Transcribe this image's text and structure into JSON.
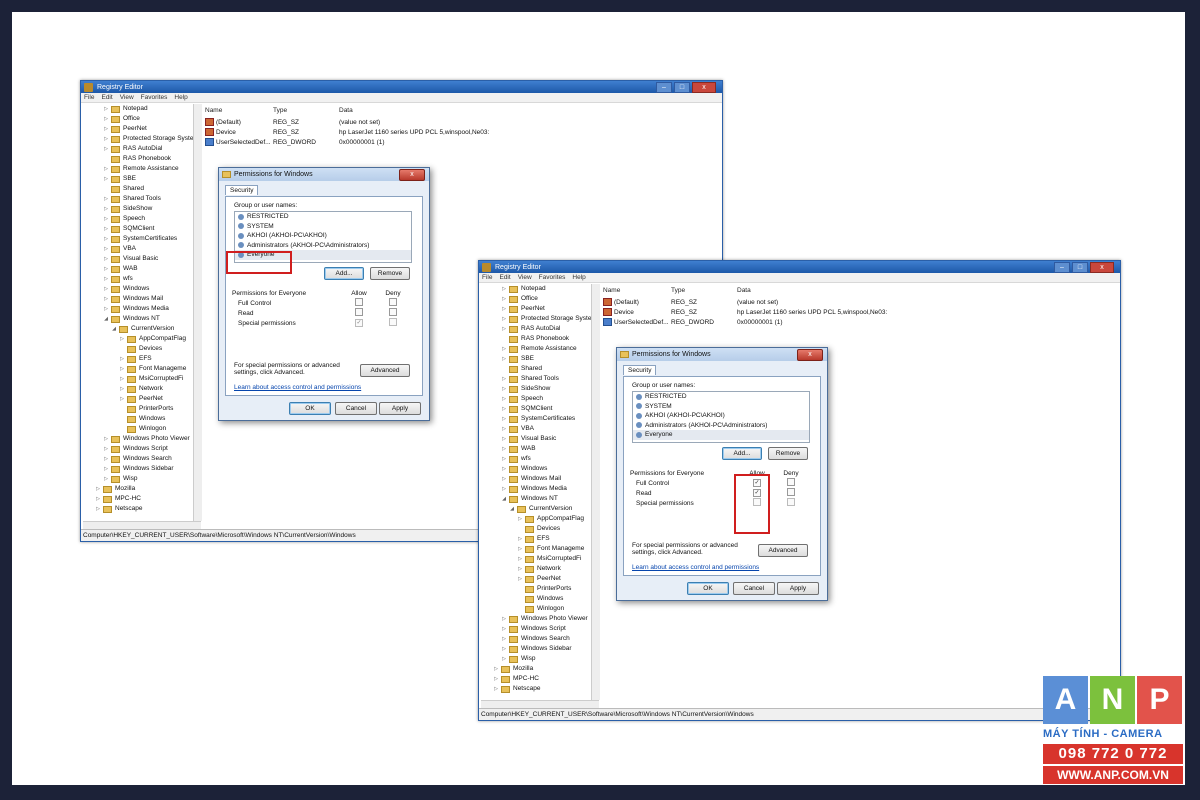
{
  "registry": {
    "title": "Registry Editor",
    "menu": [
      "File",
      "Edit",
      "View",
      "Favorites",
      "Help"
    ],
    "window_controls": [
      "–",
      "□",
      "x"
    ],
    "tree": [
      {
        "label": "Notepad",
        "indent": 2,
        "expander": "▷"
      },
      {
        "label": "Office",
        "indent": 2,
        "expander": "▷"
      },
      {
        "label": "PeerNet",
        "indent": 2,
        "expander": "▷"
      },
      {
        "label": "Protected Storage Syste",
        "indent": 2,
        "expander": "▷"
      },
      {
        "label": "RAS AutoDial",
        "indent": 2,
        "expander": "▷"
      },
      {
        "label": "RAS Phonebook",
        "indent": 2,
        "expander": ""
      },
      {
        "label": "Remote Assistance",
        "indent": 2,
        "expander": "▷"
      },
      {
        "label": "SBE",
        "indent": 2,
        "expander": "▷"
      },
      {
        "label": "Shared",
        "indent": 2,
        "expander": ""
      },
      {
        "label": "Shared Tools",
        "indent": 2,
        "expander": "▷"
      },
      {
        "label": "SideShow",
        "indent": 2,
        "expander": "▷"
      },
      {
        "label": "Speech",
        "indent": 2,
        "expander": "▷"
      },
      {
        "label": "SQMClient",
        "indent": 2,
        "expander": "▷"
      },
      {
        "label": "SystemCertificates",
        "indent": 2,
        "expander": "▷"
      },
      {
        "label": "VBA",
        "indent": 2,
        "expander": "▷"
      },
      {
        "label": "Visual Basic",
        "indent": 2,
        "expander": "▷"
      },
      {
        "label": "WAB",
        "indent": 2,
        "expander": "▷"
      },
      {
        "label": "wfs",
        "indent": 2,
        "expander": "▷"
      },
      {
        "label": "Windows",
        "indent": 2,
        "expander": "▷"
      },
      {
        "label": "Windows Mail",
        "indent": 2,
        "expander": "▷"
      },
      {
        "label": "Windows Media",
        "indent": 2,
        "expander": "▷"
      },
      {
        "label": "Windows NT",
        "indent": 2,
        "expander": "◢"
      },
      {
        "label": "CurrentVersion",
        "indent": 3,
        "expander": "◢"
      },
      {
        "label": "AppCompatFlag",
        "indent": 4,
        "expander": "▷"
      },
      {
        "label": "Devices",
        "indent": 4,
        "expander": ""
      },
      {
        "label": "EFS",
        "indent": 4,
        "expander": "▷"
      },
      {
        "label": "Font Manageme",
        "indent": 4,
        "expander": "▷"
      },
      {
        "label": "MsiCorruptedFi",
        "indent": 4,
        "expander": "▷"
      },
      {
        "label": "Network",
        "indent": 4,
        "expander": "▷"
      },
      {
        "label": "PeerNet",
        "indent": 4,
        "expander": "▷"
      },
      {
        "label": "PrinterPorts",
        "indent": 4,
        "expander": ""
      },
      {
        "label": "Windows",
        "indent": 4,
        "expander": ""
      },
      {
        "label": "Winlogon",
        "indent": 4,
        "expander": ""
      },
      {
        "label": "Windows Photo Viewer",
        "indent": 2,
        "expander": "▷"
      },
      {
        "label": "Windows Script",
        "indent": 2,
        "expander": "▷"
      },
      {
        "label": "Windows Search",
        "indent": 2,
        "expander": "▷"
      },
      {
        "label": "Windows Sidebar",
        "indent": 2,
        "expander": "▷"
      },
      {
        "label": "Wisp",
        "indent": 2,
        "expander": "▷"
      },
      {
        "label": "Mozilla",
        "indent": 1,
        "expander": "▷"
      },
      {
        "label": "MPC-HC",
        "indent": 1,
        "expander": "▷"
      },
      {
        "label": "Netscape",
        "indent": 1,
        "expander": "▷"
      }
    ],
    "columns": {
      "name": "Name",
      "type": "Type",
      "data": "Data"
    },
    "values": [
      {
        "name": "(Default)",
        "type": "REG_SZ",
        "data": "(value not set)",
        "icon": "string-value-icon"
      },
      {
        "name": "Device",
        "type": "REG_SZ",
        "data": "hp LaserJet 1160 series UPD PCL 5,winspool,Ne03:",
        "icon": "string-value-icon"
      },
      {
        "name": "UserSelectedDef...",
        "type": "REG_DWORD",
        "data": "0x00000001 (1)",
        "icon": "dword-value-icon"
      }
    ],
    "status_path": "Computer\\HKEY_CURRENT_USER\\Software\\Microsoft\\Windows NT\\CurrentVersion\\Windows"
  },
  "dialog": {
    "title": "Permissions for Windows",
    "close": "x",
    "tab": "Security",
    "group_label": "Group or user names:",
    "users": [
      "RESTRICTED",
      "SYSTEM",
      "AKHOI (AKHOI-PC\\AKHOI)",
      "Administrators (AKHOI-PC\\Administrators)",
      "Everyone"
    ],
    "add": "Add...",
    "remove": "Remove",
    "perm_header": "Permissions for Everyone",
    "allow": "Allow",
    "deny": "Deny",
    "perms": [
      "Full Control",
      "Read",
      "Special permissions"
    ],
    "special_note": "For special permissions or advanced settings, click Advanced.",
    "advanced": "Advanced",
    "learn_link": "Learn about access control and permissions",
    "ok": "OK",
    "cancel": "Cancel",
    "apply": "Apply"
  },
  "dialog_state_1": {
    "allow": [
      false,
      false,
      true
    ],
    "deny": [
      false,
      false,
      false
    ]
  },
  "dialog_state_2": {
    "allow": [
      true,
      true,
      false
    ],
    "deny": [
      false,
      false,
      false
    ]
  },
  "logo": {
    "letters": [
      "A",
      "N",
      "P"
    ],
    "tagline": "MÁY TÍNH - CAMERA",
    "phone": "098 772 0 772",
    "website": "WWW.ANP.COM.VN",
    "colors": {
      "a": "#5b8fd6",
      "n": "#7cc13d",
      "p": "#e2534b",
      "text": "#2b6cc4",
      "band": "#d8342c"
    }
  }
}
